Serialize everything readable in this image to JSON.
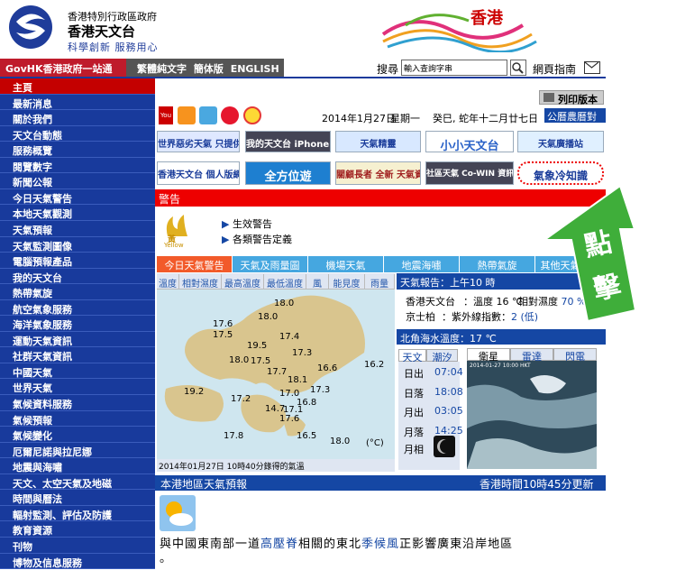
{
  "header": {
    "line1": "香港特別行政區政府",
    "line2": "香港天文台",
    "slogan": "科學創新 服務用心",
    "brand": "香港"
  },
  "govbar": {
    "govhk": "GovHK香港政府一站通",
    "langs": [
      "繁體純文字",
      "簡体版",
      "ENGLISH"
    ],
    "search_label": "搜尋",
    "search_value": "輸入查詢字串",
    "site_index": "網頁指南"
  },
  "sidebar": {
    "items": [
      "主頁",
      "最新消息",
      "關於我們",
      "天文台動態",
      "服務概覽",
      "閱覽數字",
      "新聞公報",
      "今日天氣警告",
      "本地天氣觀測",
      "天氣預報",
      "天氣監測圖像",
      "電腦預報產品",
      "我的天文台",
      "熱帶氣旋",
      "航空氣象服務",
      "海洋氣象服務",
      "運動天氣資訊",
      "社群天氣資訊",
      "中國天氣",
      "世界天氣",
      "氣候資料服務",
      "氣候預報",
      "氣候變化",
      "厄爾尼諾與拉尼娜",
      "地震與海嘯",
      "天文、太空天氣及地磁",
      "時間與曆法",
      "輻射監測、評估及防護",
      "教育資源",
      "刊物",
      "博物及信息服務"
    ]
  },
  "toolbar": {
    "print_label": "列印版本",
    "date": "2014年1月27日",
    "weekday": "星期一",
    "lunar": "癸巳, 蛇年十二月廿七日",
    "almanac": "公曆農曆對照"
  },
  "banners": {
    "row1": [
      "世界惡劣天氣 只提供英文版",
      "我的天文台 iPhone 版",
      "天氣精靈",
      "小小天文台",
      "天氣廣播站"
    ],
    "row2": [
      "香港天文台 個人版網站",
      "全方位遊",
      "關顧長者 全新 天氣資訊",
      "社區天氣 Co-WIN 資訊網絡",
      "氣象冷知識"
    ]
  },
  "promo": {
    "char1": "點",
    "char2": "擊"
  },
  "warnings": {
    "title": "警告",
    "icon_label": "黃",
    "icon_sub": "Yellow",
    "links": [
      "生效警告",
      "各類警告定義"
    ]
  },
  "tabs": [
    "今日天氣警告",
    "天氣及雨量圖",
    "機場天氣",
    "地震海嘯",
    "熱帶氣旋",
    "其他天氣資料"
  ],
  "subtabs": [
    "溫度",
    "相對濕度",
    "最高溫度",
    "最低溫度",
    "風",
    "能見度",
    "雨量"
  ],
  "map": {
    "temps": [
      "18.0",
      "18.0",
      "17.6",
      "17.5",
      "17.4",
      "19.5",
      "17.3",
      "17.5",
      "18.0",
      "16.6",
      "16.2",
      "17.7",
      "18.1",
      "17.3",
      "19.2",
      "17.2",
      "17.0",
      "16.8",
      "14.7",
      "17.1",
      "17.6",
      "17.8",
      "16.5",
      "18.0"
    ],
    "unit": "(°C)",
    "caption": "2014年01月27日 10時40分錄得的氣溫"
  },
  "report": {
    "title": "天氣報告：上午10 時",
    "station": "香港天文台",
    "temp_label": "溫度",
    "temp_val": "16 ℃",
    "rh_label": "相對濕度",
    "rh_val": "70 %",
    "kp": "京士柏",
    "uv_label": "紫外線指數",
    "uv_val": "2 (低)"
  },
  "sea": {
    "title": "北角海水溫度：17 ℃"
  },
  "astro": {
    "tabs": [
      "天文",
      "潮汐"
    ],
    "rows": [
      {
        "label": "日出",
        "value": "07:04"
      },
      {
        "label": "日落",
        "value": "18:08"
      },
      {
        "label": "月出",
        "value": "03:05"
      },
      {
        "label": "月落",
        "value": "14:25"
      }
    ],
    "moon_label": "月相"
  },
  "sat": {
    "tabs": [
      "衛星",
      "雷達",
      "閃電"
    ],
    "stamp": "2014-01-27 10:00 HKT"
  },
  "forecast": {
    "title": "本港地區天氣預報",
    "time": "香港時間10時45分更新",
    "text_prefix": "與中國東南部一道",
    "link1": "高壓脊",
    "text_mid": "相關的東北",
    "link2": "季候風",
    "text_suffix": "正影響廣東沿岸地區",
    "text_end": "。"
  },
  "colors": {
    "sidebar": "#183a9c",
    "red": "#e00000",
    "tab": "#45a7e0",
    "tab_active": "#f25a2a",
    "promo": "#3fae3a"
  }
}
